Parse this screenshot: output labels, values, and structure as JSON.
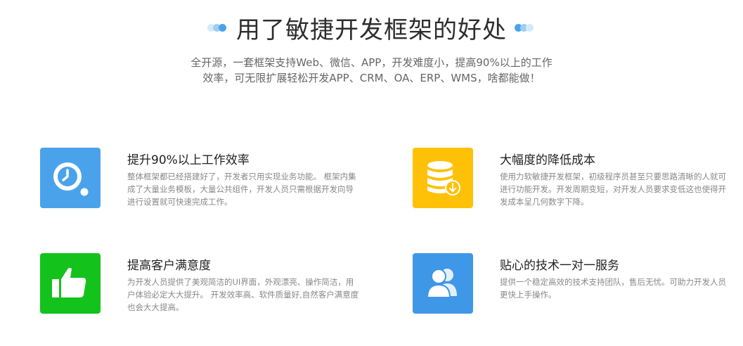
{
  "header": {
    "title": "用了敏捷开发框架的好处",
    "subtitle_line1": "全开源，一套框架支持Web、微信、APP，开发难度小，提高90%以上的工作",
    "subtitle_line2": "效率，可无限扩展轻松开发APP、CRM、OA、ERP、WMS，啥都能做！"
  },
  "features": [
    {
      "title": "提升90%以上工作效率",
      "description": "整体框架都已经搭建好了，开发者只用实现业务功能。 框架内集成了大量业务模板，大量公共组件，开发人员只需根据开发向导进行设置就可快速完成工作。",
      "icon": "clock-icon",
      "color": "#4aa3ea"
    },
    {
      "title": "大幅度的降低成本",
      "description": "使用力软敏捷开发框架，初级程序员甚至只要思路清晰的人就可进行功能开发。开发周期变短，对开发人员要求变低这也使得开发成本呈几何数字下降。",
      "icon": "database-icon",
      "color": "#ffc107"
    },
    {
      "title": "提高客户满意度",
      "description": "为开发人员提供了美观简洁的UI界面，外观漂亮、操作简洁，用户体验必定大大提升。 开发效率高、软件质量好,自然客户满意度也会大大提高。",
      "icon": "thumbs-up-icon",
      "color": "#14c21c"
    },
    {
      "title": "贴心的技术一对一服务",
      "description": "提供一个稳定高效的技术支持团队，售后无忧。可助力开发人员更快上手操作。",
      "icon": "users-icon",
      "color": "#3f97e8"
    }
  ]
}
